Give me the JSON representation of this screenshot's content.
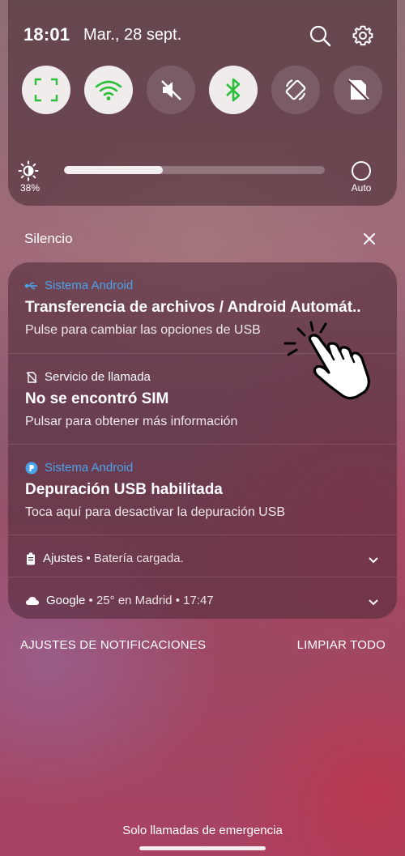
{
  "status": {
    "time": "18:01",
    "date": "Mar., 28 sept."
  },
  "header_icons": [
    "search-icon",
    "gear-icon"
  ],
  "quick_tiles": [
    {
      "name": "screen-capture",
      "icon": "screen-capture-icon",
      "state": "on"
    },
    {
      "name": "wifi",
      "icon": "wifi-icon",
      "state": "on"
    },
    {
      "name": "sound",
      "icon": "mute-icon",
      "state": "off"
    },
    {
      "name": "bluetooth",
      "icon": "bluetooth-icon",
      "state": "on"
    },
    {
      "name": "auto-rotate",
      "icon": "rotate-icon",
      "state": "off"
    },
    {
      "name": "mobile-data",
      "icon": "no-sim-icon",
      "state": "off"
    }
  ],
  "brightness": {
    "percent_label": "38%",
    "level": 0.38,
    "auto_label": "Auto"
  },
  "section": {
    "title": "Silencio"
  },
  "notifications": [
    {
      "app": "Sistema Android",
      "title": "Transferencia de archivos / Android Automát..",
      "body": "Pulse para cambiar las opciones de USB",
      "icon": "usb-icon"
    },
    {
      "app": "Servicio de llamada",
      "title": "No se encontró SIM",
      "body": "Pulsar para obtener más información",
      "icon": "no-sim-icon"
    },
    {
      "app": "Sistema Android",
      "title": "Depuración USB habilitada",
      "body": "Toca aquí para desactivar la depuración USB",
      "icon": "android-debug-icon"
    }
  ],
  "collapsed_notifications": [
    {
      "app": "Ajustes",
      "separator": " • ",
      "text": "Batería cargada.",
      "icon": "battery-icon"
    },
    {
      "app": "Google",
      "separator": " • ",
      "text": "25° en Madrid • 17:47",
      "icon": "cloud-icon"
    }
  ],
  "footer": {
    "settings_label": "AJUSTES DE NOTIFICACIONES",
    "clear_label": "LIMPIAR TODO",
    "emergency_text": "Solo llamadas de emergencia"
  },
  "colors": {
    "accent_blue": "#4aa3e8",
    "tile_green": "#2bbf3a",
    "tile_on_bg": "#f1ecec"
  }
}
